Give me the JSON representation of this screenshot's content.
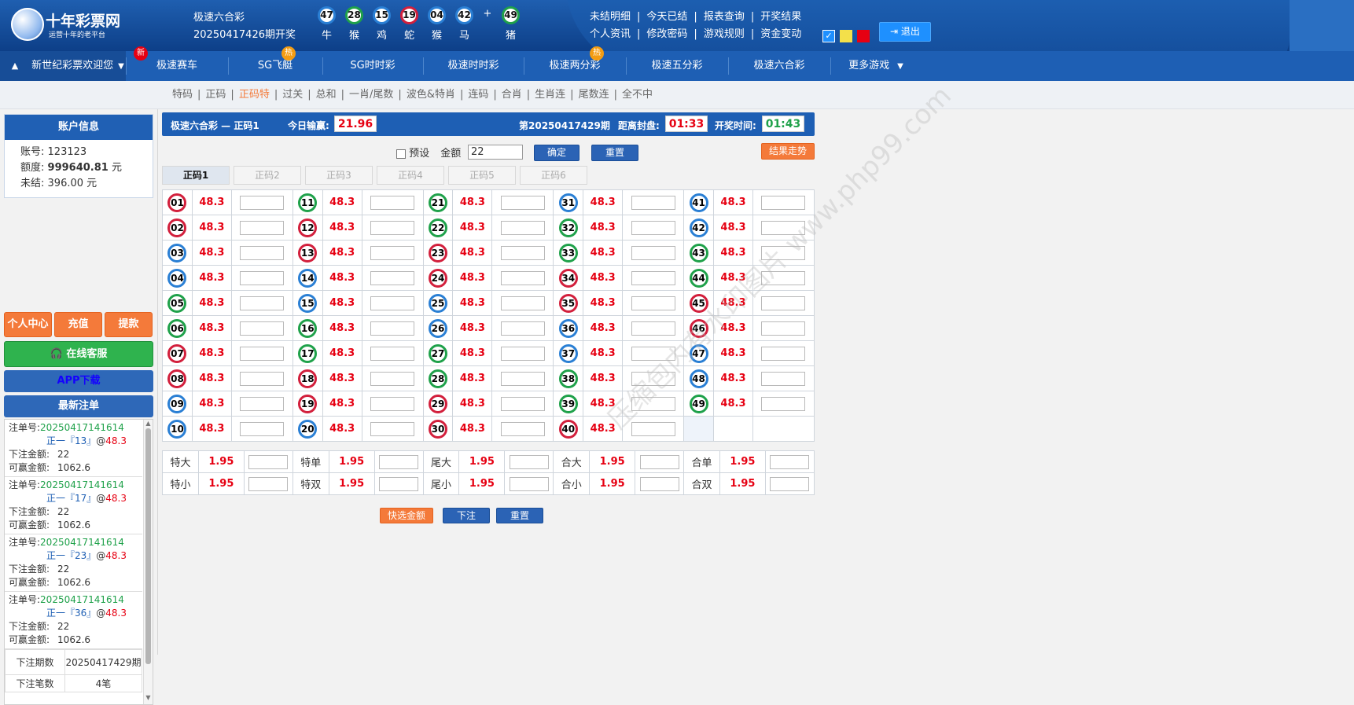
{
  "logo": {
    "name": "十年彩票网",
    "slogan": "运营十年的老平台"
  },
  "lottery": {
    "name": "极速六合彩",
    "issue": "20250417426期开奖"
  },
  "draw": [
    {
      "num": "47",
      "zodiac": "牛",
      "color": "#2a7fd4"
    },
    {
      "num": "28",
      "zodiac": "猴",
      "color": "#1fa14a"
    },
    {
      "num": "15",
      "zodiac": "鸡",
      "color": "#2a7fd4"
    },
    {
      "num": "19",
      "zodiac": "蛇",
      "color": "#d21f3c"
    },
    {
      "num": "04",
      "zodiac": "猴",
      "color": "#2a7fd4"
    },
    {
      "num": "42",
      "zodiac": "马",
      "color": "#2a7fd4"
    }
  ],
  "draw_plus": "+",
  "draw_special": {
    "num": "49",
    "zodiac": "猪",
    "color": "#1fa14a"
  },
  "toplinks": {
    "row1": [
      "未结明细",
      "今天已结",
      "报表查询",
      "开奖结果"
    ],
    "row2": [
      "个人资讯",
      "修改密码",
      "游戏规则",
      "资金变动"
    ],
    "sep": "|"
  },
  "logout": "退出",
  "nav": {
    "items": [
      "新世纪彩票欢迎您",
      "极速赛车",
      "SG飞艇",
      "SG时时彩",
      "极速时时彩",
      "极速两分彩",
      "极速五分彩",
      "极速六合彩",
      "更多游戏"
    ],
    "badge_new": "新",
    "badge_hot": "热",
    "up_icon": "▲",
    "more_icon": "▼"
  },
  "subnav": {
    "items": [
      "特码",
      "正码",
      "正码特",
      "过关",
      "总和",
      "一肖/尾数",
      "波色&特肖",
      "连码",
      "合肖",
      "生肖连",
      "尾数连",
      "全不中"
    ],
    "active": "正码特",
    "sep": "|"
  },
  "account": {
    "title": "账户信息",
    "account_label": "账号:",
    "account": "123123",
    "quota_label": "额度:",
    "quota": "999640.81",
    "quota_unit": "元",
    "unsettled_label": "未结:",
    "unsettled": "396.00 元"
  },
  "actions": {
    "center": "个人中心",
    "deposit": "充值",
    "withdraw": "提款",
    "service": "在线客服",
    "app": "APP下载",
    "recent": "最新注单"
  },
  "recent_bets": [
    {
      "no_label": "注单号:",
      "no": "20250417141614",
      "detail": "正一『13』",
      "at": "@",
      "odds": "48.3",
      "amount_label": "下注金额:",
      "amount": "22",
      "win_label": "可赢金额:",
      "win": "1062.6"
    },
    {
      "no_label": "注单号:",
      "no": "20250417141614",
      "detail": "正一『17』",
      "at": "@",
      "odds": "48.3",
      "amount_label": "下注金额:",
      "amount": "22",
      "win_label": "可赢金额:",
      "win": "1062.6"
    },
    {
      "no_label": "注单号:",
      "no": "20250417141614",
      "detail": "正一『23』",
      "at": "@",
      "odds": "48.3",
      "amount_label": "下注金额:",
      "amount": "22",
      "win_label": "可赢金额:",
      "win": "1062.6"
    },
    {
      "no_label": "注单号:",
      "no": "20250417141614",
      "detail": "正一『36』",
      "at": "@",
      "odds": "48.3",
      "amount_label": "下注金额:",
      "amount": "22",
      "win_label": "可赢金额:",
      "win": "1062.6"
    }
  ],
  "bet_summary": {
    "period_label": "下注期数",
    "period": "20250417429期",
    "count_label": "下注笔数",
    "count": "4笔"
  },
  "title_bar": {
    "title": "极速六合彩 — 正码1",
    "today_label": "今日输赢:",
    "today": "21.96",
    "period": "第20250417429期",
    "close_label": "距离封盘:",
    "close": "01:33",
    "open_label": "开奖时间:",
    "open": "01:43"
  },
  "controls": {
    "preset": "预设",
    "amount_label": "金额",
    "amount": "22",
    "confirm": "确定",
    "reset": "重置",
    "trend": "结果走势"
  },
  "tabs": [
    "正码1",
    "正码2",
    "正码3",
    "正码4",
    "正码5",
    "正码6"
  ],
  "odds": "48.3",
  "ball_colors": {
    "r": [
      "01",
      "02",
      "07",
      "08",
      "12",
      "13",
      "18",
      "19",
      "23",
      "24",
      "29",
      "30",
      "34",
      "35",
      "40",
      "45",
      "46"
    ],
    "g": [
      "05",
      "06",
      "11",
      "16",
      "17",
      "21",
      "22",
      "27",
      "28",
      "32",
      "33",
      "38",
      "39",
      "43",
      "44",
      "49"
    ]
  },
  "side_bets": [
    [
      {
        "label": "特大",
        "odds": "1.95"
      },
      {
        "label": "特单",
        "odds": "1.95"
      },
      {
        "label": "尾大",
        "odds": "1.95"
      },
      {
        "label": "合大",
        "odds": "1.95"
      },
      {
        "label": "合单",
        "odds": "1.95"
      }
    ],
    [
      {
        "label": "特小",
        "odds": "1.95"
      },
      {
        "label": "特双",
        "odds": "1.95"
      },
      {
        "label": "尾小",
        "odds": "1.95"
      },
      {
        "label": "合小",
        "odds": "1.95"
      },
      {
        "label": "合双",
        "odds": "1.95"
      }
    ]
  ],
  "bottom": {
    "quick": "快选金额",
    "submit": "下注",
    "reset": "重置"
  },
  "watermark": "压缩包内有水印图片 www.php99.com"
}
